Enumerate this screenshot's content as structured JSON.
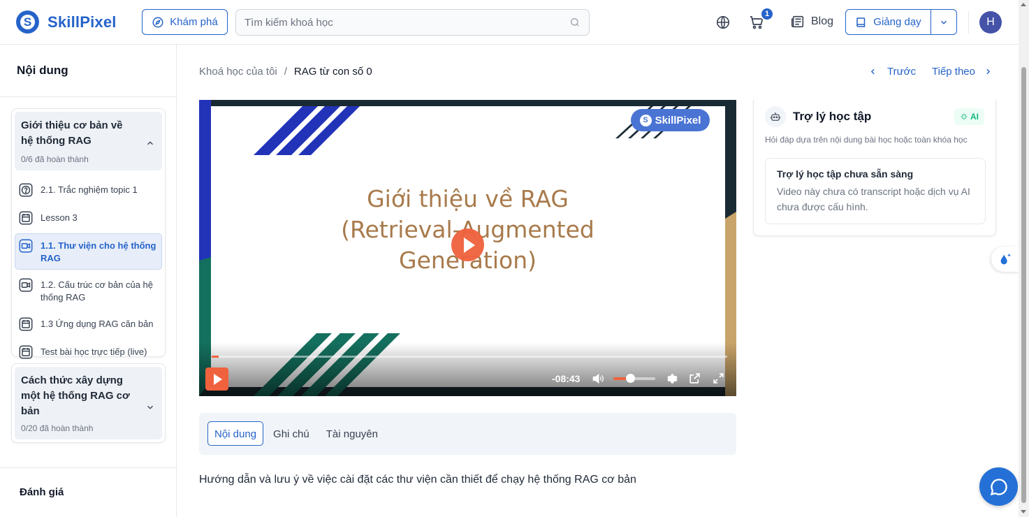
{
  "header": {
    "logo_text": "SkillPixel",
    "explore_label": "Khám phá",
    "search_placeholder": "Tìm kiếm khoá học",
    "cart_count": "1",
    "blog_label": "Blog",
    "teach_label": "Giảng dạy",
    "avatar_initial": "H"
  },
  "sidebar": {
    "title": "Nội dung",
    "sections": [
      {
        "title": "Giới thiệu cơ bản về hệ thống RAG",
        "progress": "0/6 đã hoàn thành",
        "expanded": true,
        "lessons": [
          {
            "label": "2.1. Trắc nghiệm topic 1",
            "icon": "quiz-icon"
          },
          {
            "label": "Lesson 3",
            "icon": "calendar-icon"
          },
          {
            "label": "1.1. Thư viện cho hệ thống RAG",
            "icon": "video-icon",
            "active": true
          },
          {
            "label": "1.2. Cấu trúc cơ bản của hệ thống RAG",
            "icon": "video-icon"
          },
          {
            "label": "1.3 Ứng dụng RAG căn bản",
            "icon": "calendar-icon"
          },
          {
            "label": "Test bài học trực tiếp (live)",
            "icon": "calendar-icon"
          }
        ]
      },
      {
        "title": "Cách thức xây dựng một hệ thống RAG cơ bản",
        "progress": "0/20 đã hoàn thành",
        "expanded": false
      }
    ],
    "review_label": "Đánh giá"
  },
  "breadcrumb": {
    "parent": "Khoá học của tôi",
    "separator": "/",
    "current": "RAG từ con số 0"
  },
  "pager": {
    "prev_label": "Trước",
    "next_label": "Tiếp theo"
  },
  "video": {
    "watermark": "SkillPixel",
    "slide_title_line1": "Giới thiệu về RAG",
    "slide_title_line2": "(Retrieval-Augmented",
    "slide_title_line3": "Generation)",
    "time_remaining": "-08:43",
    "progress_fraction": 0.013,
    "volume_fraction": 0.4
  },
  "tabs": [
    {
      "label": "Nội dung",
      "active": true
    },
    {
      "label": "Ghi chú"
    },
    {
      "label": "Tài nguyên"
    }
  ],
  "description": "Hướng dẫn và lưu ý về việc cài đặt các thư viện cần thiết để chạy hệ thống RAG cơ bản",
  "assistant": {
    "title": "Trợ lý học tập",
    "badge": "AI",
    "subtitle": "Hỏi đáp dựa trên nội dung bài học hoặc toàn khóa học",
    "status_title": "Trợ lý học tập chưa sẵn sàng",
    "status_text": "Video này chưa có transcript hoặc dịch vụ AI chưa được cấu hình."
  },
  "colors": {
    "brand": "#2563c9",
    "accent_video": "#f0623d",
    "ai_badge": "#10b981"
  }
}
